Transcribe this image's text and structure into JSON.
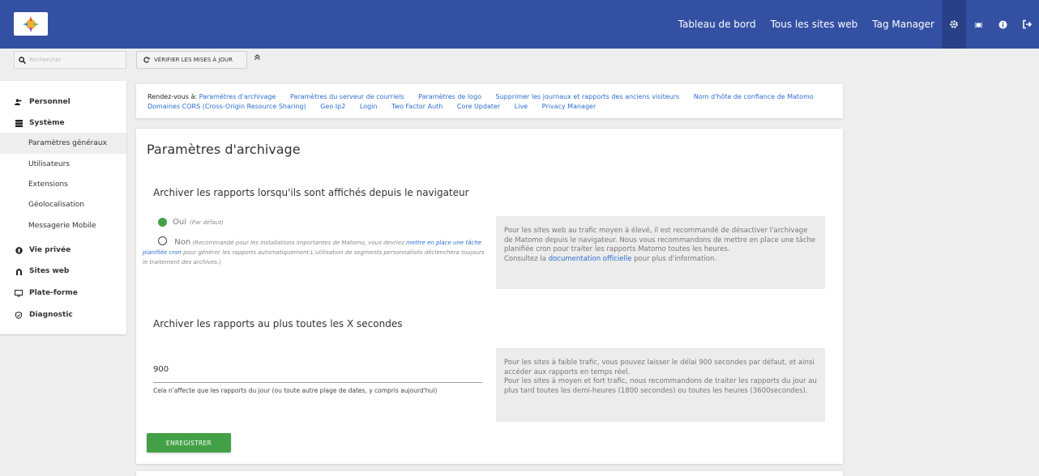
{
  "topnav": {
    "links": [
      "Tableau de bord",
      "Tous les sites web",
      "Tag Manager"
    ],
    "icons": [
      "gear-icon",
      "bug-icon",
      "info-icon",
      "logout-icon"
    ]
  },
  "search": {
    "placeholder": "Rechercher"
  },
  "toolbar": {
    "update_label": "Vérifier les mises à jour",
    "collapse_icon": "double-chevron-up-icon"
  },
  "sidebar": {
    "categories": [
      {
        "label": "Personnel",
        "icon": "user-icon"
      },
      {
        "label": "Système",
        "icon": "server-icon"
      },
      {
        "label": "Vie privée",
        "icon": "privacy-icon"
      },
      {
        "label": "Sites web",
        "icon": "globe-icon"
      },
      {
        "label": "Plate-forme",
        "icon": "monitor-icon"
      },
      {
        "label": "Diagnostic",
        "icon": "shield-icon"
      }
    ],
    "items": [
      "Paramètres généraux",
      "Utilisateurs",
      "Extensions",
      "Géolocalisation",
      "Messagerie Mobile"
    ],
    "active_item": "Paramètres généraux"
  },
  "links_card": {
    "prefix": "Rendez-vous à:",
    "links": [
      "Paramètres d'archivage",
      "Paramètres du serveur de courriels",
      "Paramètres de logo",
      "Supprimer les journaux et rapports des anciens visiteurs",
      "Nom d'hôte de confiance de Matomo",
      "Domaines CORS (Cross-Origin Resource Sharing)",
      "Geo Ip2",
      "Login",
      "Two Factor Auth",
      "Core Updater",
      "Live",
      "Privacy Manager"
    ]
  },
  "main": {
    "title": "Paramètres d'archivage",
    "section1": {
      "heading": "Archiver les rapports lorsqu'ils sont affichés depuis le navigateur",
      "option_yes": {
        "label": "Oui",
        "hint": "(Par défaut)"
      },
      "option_no": {
        "label": "Non",
        "hint_before": "(Recommandé pour les installations importantes de Matomo, vous devriez",
        "hint_link": "mettre en place une tâche planifiée cron",
        "hint_after": "pour générer les rapports automatiquement.L'utilisation de segments personnalisés déclenchera toujours le traitement des archives.)"
      },
      "selected": "Oui",
      "info_text": "Pour les sites web au trafic moyen à élevé, il est recommandé de désactiver l'archivage de Matomo depuis le navigateur. Nous vous recommandons de mettre en place une tâche planifiée cron pour traiter les rapports Matomo toutes les heures.",
      "info_link_prefix": "Consultez la",
      "info_link": "documentation officielle",
      "info_link_suffix": "pour plus d'information."
    },
    "section2": {
      "heading": "Archiver les rapports au plus toutes les X secondes",
      "value": "900",
      "help": "Cela n'affecte que les rapports du jour (ou toute autre plage de dates, y compris aujourd'hui)",
      "info_line1": "Pour les sites à faible trafic, vous pouvez laisser le délai 900 secondes par défaut, et ainsi accéder aux rapports en temps réel.",
      "info_line2": "Pour les sites à moyen et fort trafic, nous recommandons de traiter les rapports du jour au plus tard toutes les demi-heures (1800 secondes) ou toutes les heures (3600secondes)."
    },
    "save_label": "Enregistrer"
  },
  "colors": {
    "topbar": "#3450a3",
    "accent_green": "#43a047",
    "link": "#2b6ed1"
  }
}
